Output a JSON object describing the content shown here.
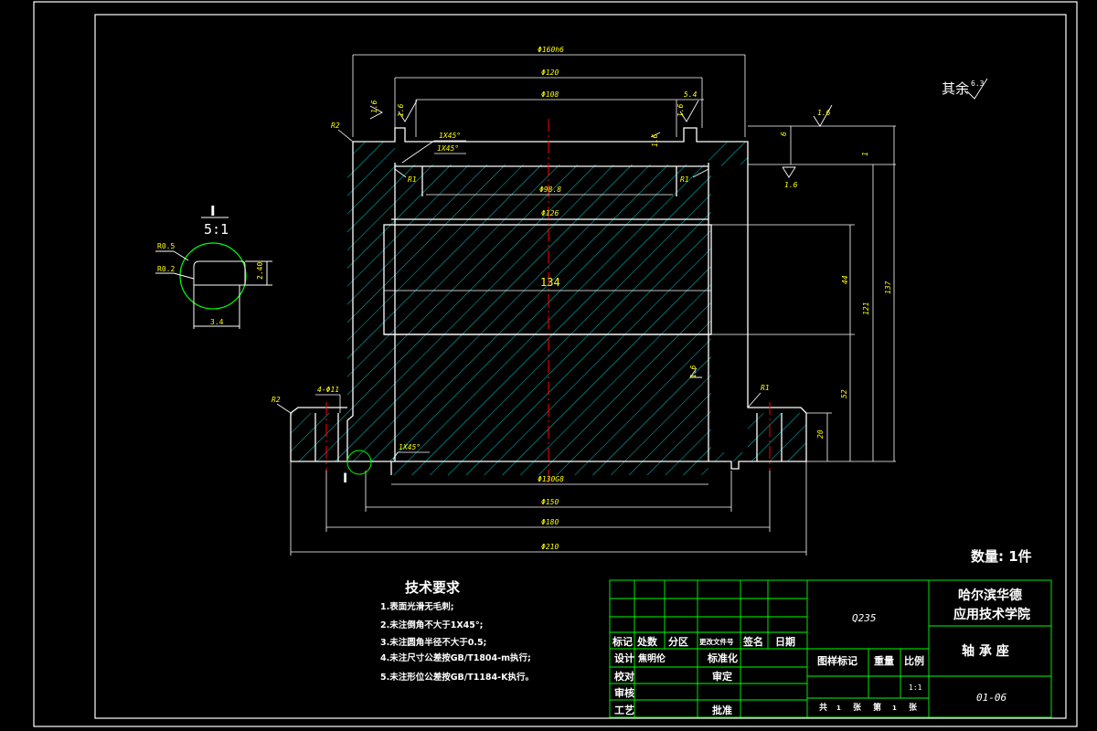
{
  "colors": {
    "frame": "#ffffff",
    "dimension": "#ffff00",
    "hatch": "#00c8c8",
    "table_grid": "#00ff00",
    "centerline": "#ff0000",
    "detail_circle": "#00ff00"
  },
  "roughness_note": "其余",
  "roughness_note_value": "6.3",
  "quantity_label": "数量: 1件",
  "dimensions": {
    "outer_top": "Φ160h6",
    "top_120": "Φ120",
    "top_108": "Φ108",
    "groove_width": "5.4",
    "bore_98": "Φ98.8",
    "bore_126": "Φ126",
    "bore_134": "134",
    "base_130": "Φ130G8",
    "base_150": "Φ150",
    "base_180": "Φ180",
    "base_210": "Φ210",
    "chamfer_top1": "1X45°",
    "chamfer_top2": "1X45°",
    "chamfer_bottom": "1X45°",
    "holes": "4-Φ11",
    "r_top_left": "R2",
    "r_base_left": "R2",
    "r_base_right": "R1",
    "r_inner_left": "R1",
    "r_inner_right": "R1",
    "h_6": "6",
    "h_1": "1",
    "h_44": "44",
    "h_121": "121",
    "h_137": "137",
    "h_52": "52",
    "h_20": "20",
    "rough_top": "1.6",
    "rough_mid": "1.6",
    "rough_groove_l1": "1.6",
    "rough_groove_l2": "1.6",
    "rough_groove_r1": "1.6",
    "rough_groove_r2": "1.6",
    "rough_side": "1.6"
  },
  "detail": {
    "label": "I",
    "scale": "5:1",
    "r1": "R0.5",
    "r2": "R0.2",
    "height": "2.40",
    "width": "3.4",
    "marker": "I"
  },
  "tech_requirements": {
    "title": "技术要求",
    "items": [
      "1.表面光滑无毛刺;",
      "2.未注倒角不大于1X45°;",
      "3.未注圆角半径不大于0.5;",
      "4.未注尺寸公差按GB/T1804-m执行;",
      "5.未注形位公差按GB/T1184-K执行。"
    ]
  },
  "title_block": {
    "material": "Q235",
    "school_line1": "哈尔滨华德",
    "school_line2": "应用技术学院",
    "part_name": "轴 承 座",
    "drawing_no": "01-06",
    "scale_value": "1:1",
    "row_headers": [
      "标记",
      "处数",
      "分区",
      "更改文件号",
      "签名",
      "日期"
    ],
    "designer_label": "设计",
    "designer_name": "焦明伦",
    "standardize_label": "标准化",
    "check_label": "校对",
    "approve_label": "审定",
    "review_label": "审核",
    "process_label": "工艺",
    "ratify_label": "批准",
    "stage_label": "图样标记",
    "weight_label": "重量",
    "ratio_label": "比例",
    "sheets_total_label": "共",
    "sheets_total": "1",
    "sheet_label": "张",
    "sheet_no_label": "第",
    "sheet_no": "1",
    "sheet_label2": "张"
  }
}
